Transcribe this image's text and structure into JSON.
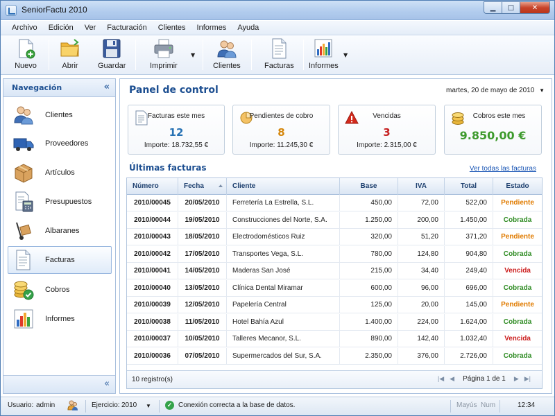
{
  "window": {
    "title": "SeniorFactu 2010",
    "min": "▁",
    "max": "□",
    "close": "✕"
  },
  "menu": [
    "Archivo",
    "Edición",
    "Ver",
    "Facturación",
    "Clientes",
    "Informes",
    "Ayuda"
  ],
  "toolbar": {
    "nuevo": "Nuevo",
    "abrir": "Abrir",
    "guardar": "Guardar",
    "imprimir": "Imprimir",
    "clientes": "Clientes",
    "facturas": "Facturas",
    "informes": "Informes",
    "dropdown": "▼"
  },
  "sidebar": {
    "title": "Navegación",
    "collapse": "«",
    "items": [
      {
        "label": "Clientes",
        "icon": "users-icon"
      },
      {
        "label": "Proveedores",
        "icon": "truck-icon"
      },
      {
        "label": "Artículos",
        "icon": "box-icon"
      },
      {
        "label": "Presupuestos",
        "icon": "calculator-icon"
      },
      {
        "label": "Albaranes",
        "icon": "handtruck-icon"
      },
      {
        "label": "Facturas",
        "icon": "document-icon"
      },
      {
        "label": "Cobros",
        "icon": "coins-icon"
      },
      {
        "label": "Informes",
        "icon": "chart-icon"
      }
    ],
    "active": "Facturas"
  },
  "main": {
    "title": "Panel de control",
    "date": "martes, 20 de mayo de 2010",
    "date_caret": "▼",
    "cards": [
      {
        "title": "Facturas este mes",
        "value": "12",
        "sub_label": "Importe:",
        "sub_value": "18.732,55 €",
        "color": "#2872b4"
      },
      {
        "title": "Pendientes de cobro",
        "value": "8",
        "sub_label": "Importe:",
        "sub_value": "11.245,30 €",
        "color": "#d5860b"
      },
      {
        "title": "Vencidas",
        "value": "3",
        "sub_label": "Importe:",
        "sub_value": "2.315,00 €",
        "color": "#c62020"
      },
      {
        "title": "Cobros este mes",
        "value": "9.850,00 €",
        "color": "#3d9a2c"
      }
    ],
    "section_title": "Últimas facturas",
    "see_all": "Ver todas las facturas"
  },
  "table": {
    "columns": [
      "Número",
      "Fecha",
      "Cliente",
      "Base",
      "IVA",
      "Total",
      "Estado"
    ],
    "rows": [
      [
        "2010/00045",
        "20/05/2010",
        "Ferretería La Estrella, S.L.",
        "450,00",
        "72,00",
        "522,00",
        "Pendiente"
      ],
      [
        "2010/00044",
        "19/05/2010",
        "Construcciones del Norte, S.A.",
        "1.250,00",
        "200,00",
        "1.450,00",
        "Cobrada"
      ],
      [
        "2010/00043",
        "18/05/2010",
        "Electrodomésticos Ruiz",
        "320,00",
        "51,20",
        "371,20",
        "Pendiente"
      ],
      [
        "2010/00042",
        "17/05/2010",
        "Transportes Vega, S.L.",
        "780,00",
        "124,80",
        "904,80",
        "Cobrada"
      ],
      [
        "2010/00041",
        "14/05/2010",
        "Maderas San José",
        "215,00",
        "34,40",
        "249,40",
        "Vencida"
      ],
      [
        "2010/00040",
        "13/05/2010",
        "Clínica Dental Miramar",
        "600,00",
        "96,00",
        "696,00",
        "Cobrada"
      ],
      [
        "2010/00039",
        "12/05/2010",
        "Papelería Central",
        "125,00",
        "20,00",
        "145,00",
        "Pendiente"
      ],
      [
        "2010/00038",
        "11/05/2010",
        "Hotel Bahía Azul",
        "1.400,00",
        "224,00",
        "1.624,00",
        "Cobrada"
      ],
      [
        "2010/00037",
        "10/05/2010",
        "Talleres Mecanor, S.L.",
        "890,00",
        "142,40",
        "1.032,40",
        "Vencida"
      ],
      [
        "2010/00036",
        "07/05/2010",
        "Supermercados del Sur, S.A.",
        "2.350,00",
        "376,00",
        "2.726,00",
        "Cobrada"
      ]
    ],
    "status_colors": {
      "Pendiente": "#e07b00",
      "Cobrada": "#2e8b22",
      "Vencida": "#cc1f1f"
    },
    "record_count": "10 registro(s)",
    "page_text": "Página 1 de 1",
    "pager_first": "|◀",
    "pager_prev": "◀",
    "pager_next": "▶",
    "pager_last": "▶|"
  },
  "status": {
    "user_label": "Usuario:",
    "user": "admin",
    "year_label": "Ejercicio:",
    "year": "2010",
    "year_caret": "▼",
    "ok_glyph": "✓",
    "connection": "Conexión correcta a la base de datos.",
    "caps": "Mayús",
    "num": "Num",
    "time": "12:34"
  }
}
